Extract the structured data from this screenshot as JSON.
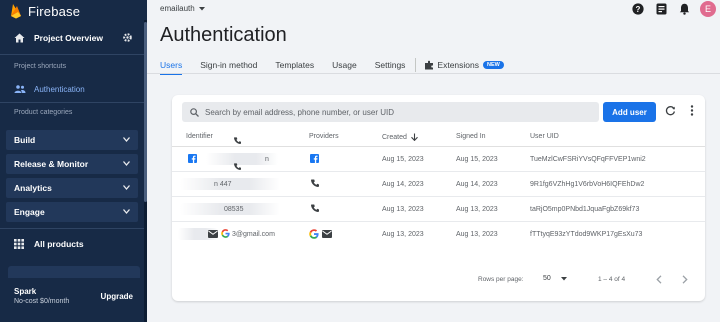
{
  "sidebar": {
    "brand": "Firebase",
    "project_overview": "Project Overview",
    "shortcuts_label": "Project shortcuts",
    "authentication": "Authentication",
    "categories_label": "Product categories",
    "categories": [
      {
        "label": "Build"
      },
      {
        "label": "Release & Monitor"
      },
      {
        "label": "Analytics"
      },
      {
        "label": "Engage"
      }
    ],
    "all_products": "All products",
    "plan_name": "Spark",
    "plan_price": "No-cost $0/month",
    "upgrade": "Upgrade"
  },
  "header": {
    "project": "emailauth",
    "avatar_letter": "E"
  },
  "page": {
    "title": "Authentication",
    "tabs": [
      {
        "label": "Users",
        "active": true
      },
      {
        "label": "Sign-in method"
      },
      {
        "label": "Templates"
      },
      {
        "label": "Usage"
      },
      {
        "label": "Settings"
      }
    ],
    "extensions_label": "Extensions",
    "new_badge": "NEW"
  },
  "users": {
    "search_placeholder": "Search by email address, phone number, or user UID",
    "add_user": "Add user",
    "columns": {
      "identifier": "Identifier",
      "providers": "Providers",
      "created": "Created",
      "signed_in": "Signed In",
      "uid": "User UID"
    },
    "rows": [
      {
        "id_fragment": "n",
        "created": "Aug 15, 2023",
        "signed_in": "Aug 15, 2023",
        "uid": "TueMzlCwFSRiYVsQFqFFVEP1wni2",
        "providers": [
          "facebook-icon"
        ]
      },
      {
        "id_fragment": "n   447",
        "created": "Aug 14, 2023",
        "signed_in": "Aug 14, 2023",
        "uid": "9R1fg6VZhHg1V6rbVoH6IQFEhDw2",
        "providers": [
          "phone-icon"
        ]
      },
      {
        "id_fragment": "08535",
        "created": "Aug 13, 2023",
        "signed_in": "Aug 13, 2023",
        "uid": "taRjO5mp0PNbd1JquaFgbZ69kf73",
        "providers": [
          "phone-icon"
        ]
      },
      {
        "id_fragment": "3@gmail.com",
        "created": "Aug 13, 2023",
        "signed_in": "Aug 13, 2023",
        "uid": "fTTtyqE93zYTdod9WKP17gEsXu73",
        "providers": [
          "google-icon",
          "email-icon"
        ]
      }
    ],
    "pagination": {
      "rows_per_page_label": "Rows per page:",
      "rows_per_page": "50",
      "range": "1 – 4 of 4"
    }
  },
  "colors": {
    "sidebar_bg": "#172a46",
    "accent": "#1a73e8",
    "facebook": "#1877f2"
  }
}
